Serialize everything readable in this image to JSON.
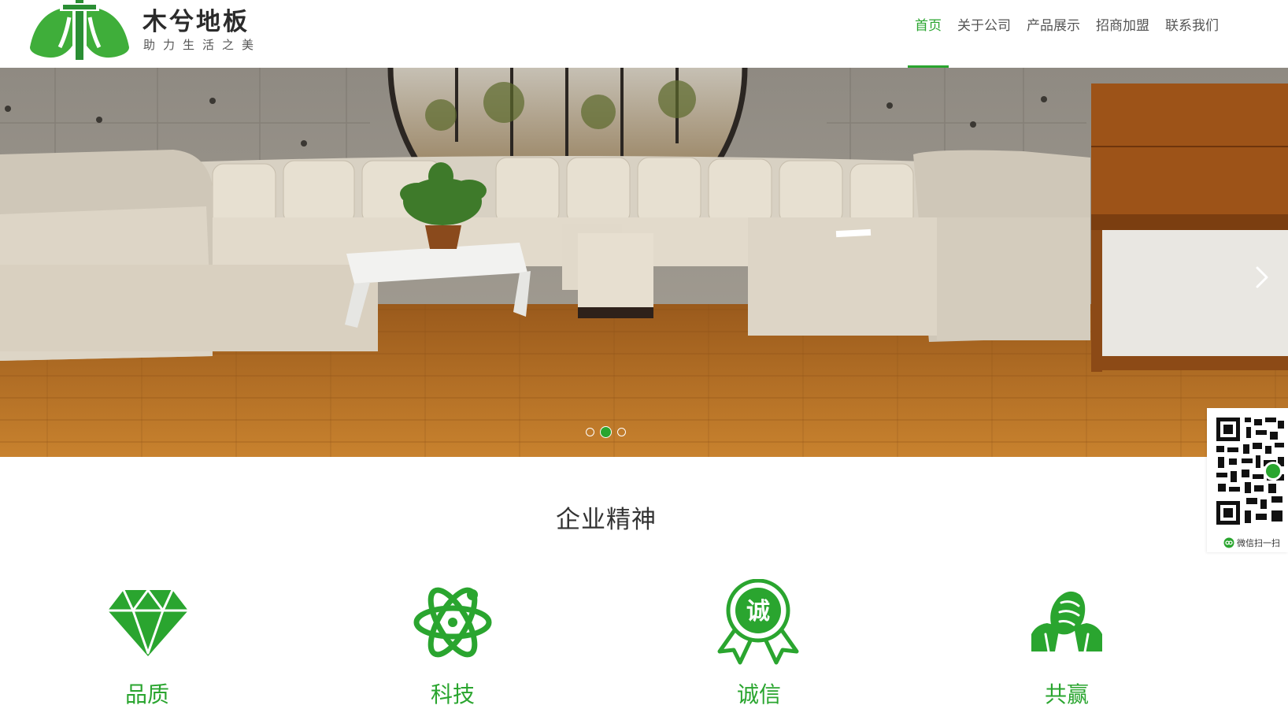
{
  "brand": {
    "name": "木兮地板",
    "slogan": "助力生活之美"
  },
  "nav": {
    "items": [
      {
        "label": "首页",
        "active": true
      },
      {
        "label": "关于公司",
        "active": false
      },
      {
        "label": "产品展示",
        "active": false
      },
      {
        "label": "招商加盟",
        "active": false
      },
      {
        "label": "联系我们",
        "active": false
      }
    ]
  },
  "banner": {
    "slide_count": 3,
    "active_slide": 2,
    "next_icon": "chevron-right-icon"
  },
  "qr": {
    "caption": "微信扫一扫"
  },
  "section": {
    "title": "企业精神",
    "values": [
      {
        "icon": "diamond-icon",
        "label": "品质"
      },
      {
        "icon": "atom-icon",
        "label": "科技"
      },
      {
        "icon": "award-ribbon-icon",
        "badge": "诚",
        "label": "诚信"
      },
      {
        "icon": "handshake-icon",
        "label": "共赢"
      }
    ]
  },
  "colors": {
    "accent": "#2aa52f",
    "text": "#333333"
  }
}
